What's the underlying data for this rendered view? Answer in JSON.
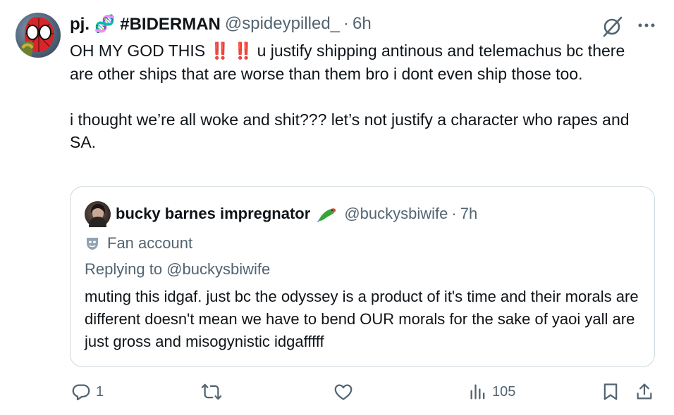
{
  "tweet": {
    "display_name": "pj. 🧬 #BIDERMAN",
    "handle": "@spideypilled_",
    "separator": "·",
    "time": "6h",
    "line1_pre": "OH MY GOD THIS ",
    "line1_bangs": "‼️ ‼️",
    "line1_post": " u justify shipping antinous and telemachus bc there are other ships that are worse than them bro i dont even ship those too.",
    "paragraph2": "i thought we’re all woke and shit??? let’s not justify a character who rapes and SA."
  },
  "quote": {
    "display_name": "bucky barnes impregnator",
    "handle": "@buckysbiwife",
    "separator": "·",
    "time": "7h",
    "badge": "Fan account",
    "replying_to": "Replying to @buckysbiwife",
    "text": "muting this idgaf. just bc the odyssey is a product of it's time and their morals are different doesn't mean we have to bend OUR morals for the sake of yaoi yall are just gross and misogynistic idgafffff"
  },
  "actions": {
    "replies": "1",
    "retweets": "",
    "likes": "",
    "views": "105"
  },
  "icons": [
    "grok-icon",
    "more-icon",
    "parrot-icon",
    "mask-icon",
    "reply-icon",
    "retweet-icon",
    "like-icon",
    "views-icon",
    "bookmark-icon",
    "share-icon"
  ],
  "colors": {
    "text": "#0f1419",
    "secondary": "#536471",
    "border": "#cfd9de",
    "bang": "#d42020"
  }
}
